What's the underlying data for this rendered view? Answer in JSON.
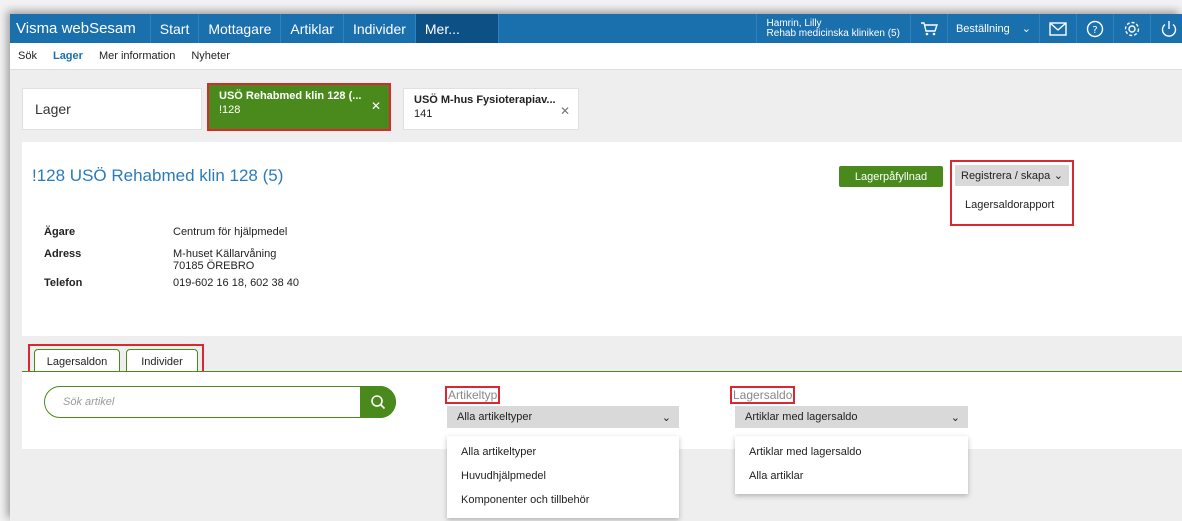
{
  "topbar": {
    "brand": "Visma webSesam",
    "nav": [
      "Start",
      "Mottagare",
      "Artiklar",
      "Individer",
      "Mer..."
    ],
    "user_name": "Hamrin, Lilly",
    "user_unit": "Rehab medicinska kliniken (5)",
    "order_label": "Beställning"
  },
  "subnav": [
    "Sök",
    "Lager",
    "Mer information",
    "Nyheter"
  ],
  "tabs": {
    "lager_label": "Lager",
    "active_title": "USÖ Rehabmed klin 128 (...",
    "active_code": "!128",
    "second_title": "USÖ M-hus Fysioterapiav...",
    "second_code": "141"
  },
  "stock": {
    "title": "!128 USÖ Rehabmed klin 128 (5)",
    "refill_button": "Lagerpåfyllnad",
    "register_button": "Registrera / skapa",
    "register_menu": [
      "Lagersaldorapport"
    ],
    "owner_label": "Ägare",
    "owner": "Centrum för hjälpmedel",
    "address_label": "Adress",
    "address_line1": "M-huset Källarvåning",
    "address_line2": "70185 ÖREBRO",
    "phone_label": "Telefon",
    "phone": "019-602 16 18, 602 38 40"
  },
  "lower_tabs": [
    "Lagersaldon",
    "Individer"
  ],
  "filters": {
    "search_placeholder": "Sök artikel",
    "article_type_label": "Artikeltyp",
    "article_type_selected": "Alla artikeltyper",
    "article_type_options": [
      "Alla artikeltyper",
      "Huvudhjälpmedel",
      "Komponenter och tillbehör"
    ],
    "stock_label": "Lagersaldo",
    "stock_selected": "Artiklar med lagersaldo",
    "stock_options": [
      "Artiklar med lagersaldo",
      "Alla artiklar"
    ]
  },
  "colors": {
    "nav_blue": "#1a6fad",
    "accent_green": "#4a8a1c",
    "highlight_red": "#d9282f"
  }
}
